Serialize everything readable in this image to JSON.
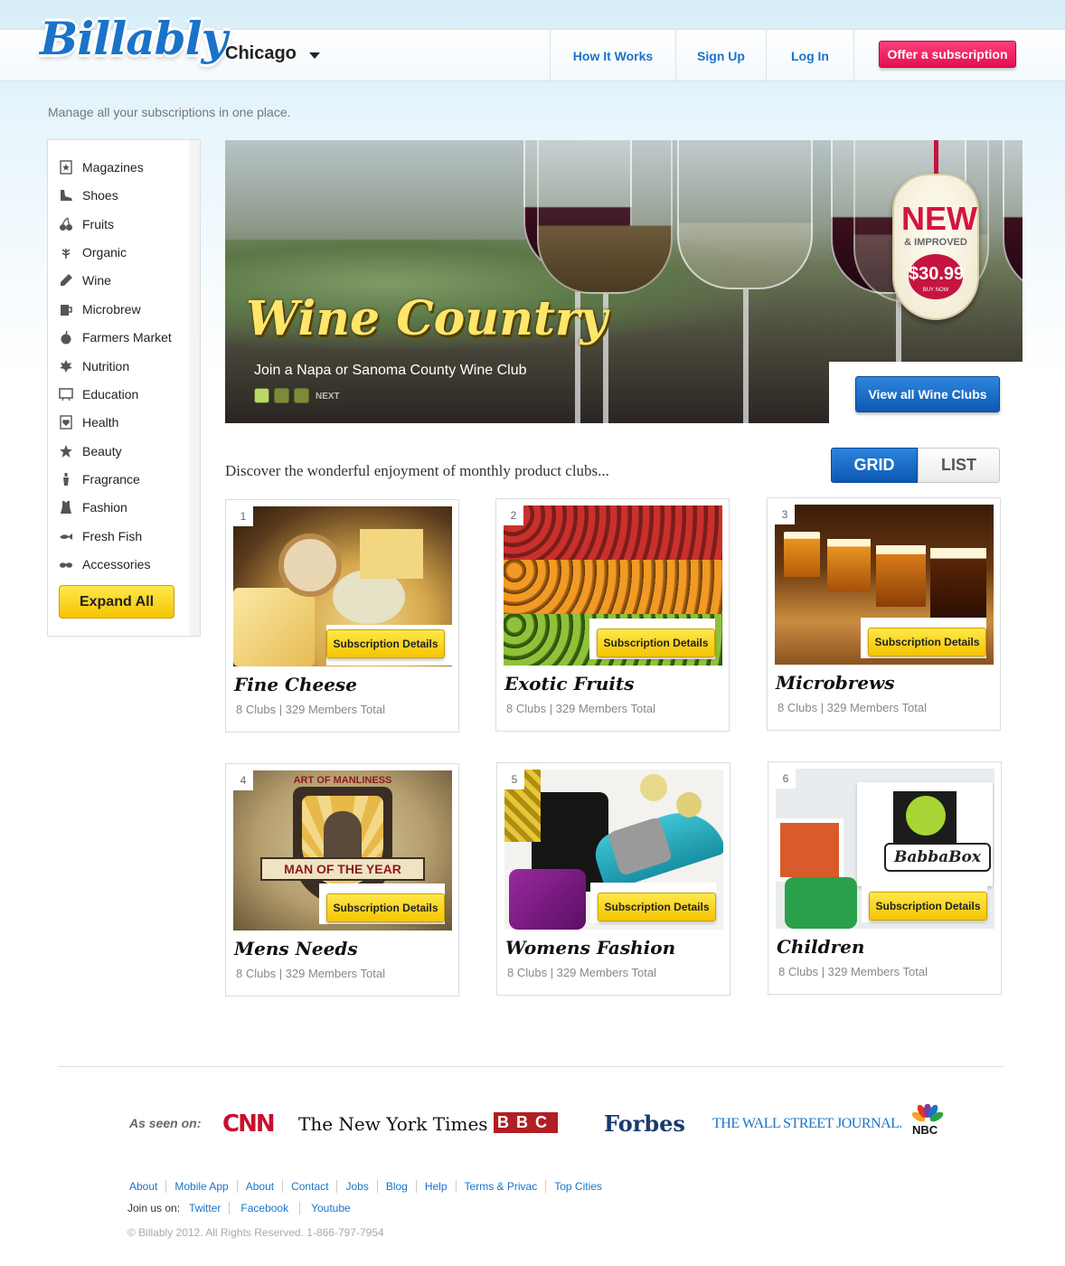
{
  "header": {
    "logo": "Billably",
    "city": "Chicago",
    "nav": [
      "How It Works",
      "Sign Up",
      "Log In"
    ],
    "offer_button": "Offer a subscription"
  },
  "tagline": "Manage all your subscriptions in one place.",
  "sidebar": {
    "items": [
      {
        "label": "Magazines",
        "icon": "magazine-icon"
      },
      {
        "label": "Shoes",
        "icon": "shoe-icon"
      },
      {
        "label": "Fruits",
        "icon": "cherries-icon"
      },
      {
        "label": "Organic",
        "icon": "plant-icon"
      },
      {
        "label": "Wine",
        "icon": "wine-bottle-icon"
      },
      {
        "label": "Microbrew",
        "icon": "beer-mug-icon"
      },
      {
        "label": "Farmers Market",
        "icon": "apple-icon"
      },
      {
        "label": "Nutrition",
        "icon": "leaf-icon"
      },
      {
        "label": "Education",
        "icon": "chalkboard-icon"
      },
      {
        "label": "Health",
        "icon": "heart-card-icon"
      },
      {
        "label": "Beauty",
        "icon": "star-icon"
      },
      {
        "label": "Fragrance",
        "icon": "perfume-icon"
      },
      {
        "label": "Fashion",
        "icon": "dress-icon"
      },
      {
        "label": "Fresh Fish",
        "icon": "fish-icon"
      },
      {
        "label": "Accessories",
        "icon": "sunglasses-icon"
      }
    ],
    "expand_label": "Expand All"
  },
  "hero": {
    "title": "Wine Country",
    "subtitle": "Join a Napa or Sanoma County Wine Club",
    "next_label": "NEXT",
    "tag_new": "NEW",
    "tag_improved": "& IMPROVED",
    "tag_price": "$30.99",
    "tag_buy": "BUY NOW",
    "cta": "View all Wine Clubs",
    "dot_colors": [
      "#b9d76a",
      "#7c8a3a",
      "#7c8a3a"
    ]
  },
  "discover": "Discover the wonderful enjoyment of monthly product clubs...",
  "view_toggle": {
    "grid": "GRID",
    "list": "LIST",
    "selected": "GRID"
  },
  "clubs": [
    {
      "num": "1",
      "title": "Fine Cheese",
      "meta": "8 Clubs | 329 Members Total",
      "button": "Subscription Details"
    },
    {
      "num": "2",
      "title": "Exotic Fruits",
      "meta": "8 Clubs | 329 Members Total",
      "button": "Subscription Details"
    },
    {
      "num": "3",
      "title": "Microbrews",
      "meta": "8 Clubs | 329 Members Total",
      "button": "Subscription Details"
    },
    {
      "num": "4",
      "title": "Mens Needs",
      "meta": "8 Clubs | 329 Members Total",
      "button": "Subscription Details",
      "img_text_top": "ART OF MANLINESS",
      "img_text_banner": "MAN OF THE YEAR"
    },
    {
      "num": "5",
      "title": "Womens Fashion",
      "meta": "8 Clubs | 329 Members Total",
      "button": "Subscription Details"
    },
    {
      "num": "6",
      "title": "Children",
      "meta": "8 Clubs | 329 Members Total",
      "button": "Subscription Details",
      "img_text_brand": "BabbaBox"
    }
  ],
  "footer": {
    "seen_on": "As seen on:",
    "press": [
      "CNN",
      "The New York Times",
      "BBC",
      "Forbes",
      "THE WALL STREET JOURNAL.",
      "NBC"
    ],
    "links": [
      "About",
      "Mobile App",
      "About",
      "Contact",
      "Jobs",
      "Blog",
      "Help",
      "Terms & Privac",
      "Top Cities"
    ],
    "join_label": "Join us on:",
    "social": [
      "Twitter",
      "Facebook",
      "Youtube"
    ],
    "copyright": "©  Billably 2012. All Rights Reserved. 1-866-797-7954"
  }
}
